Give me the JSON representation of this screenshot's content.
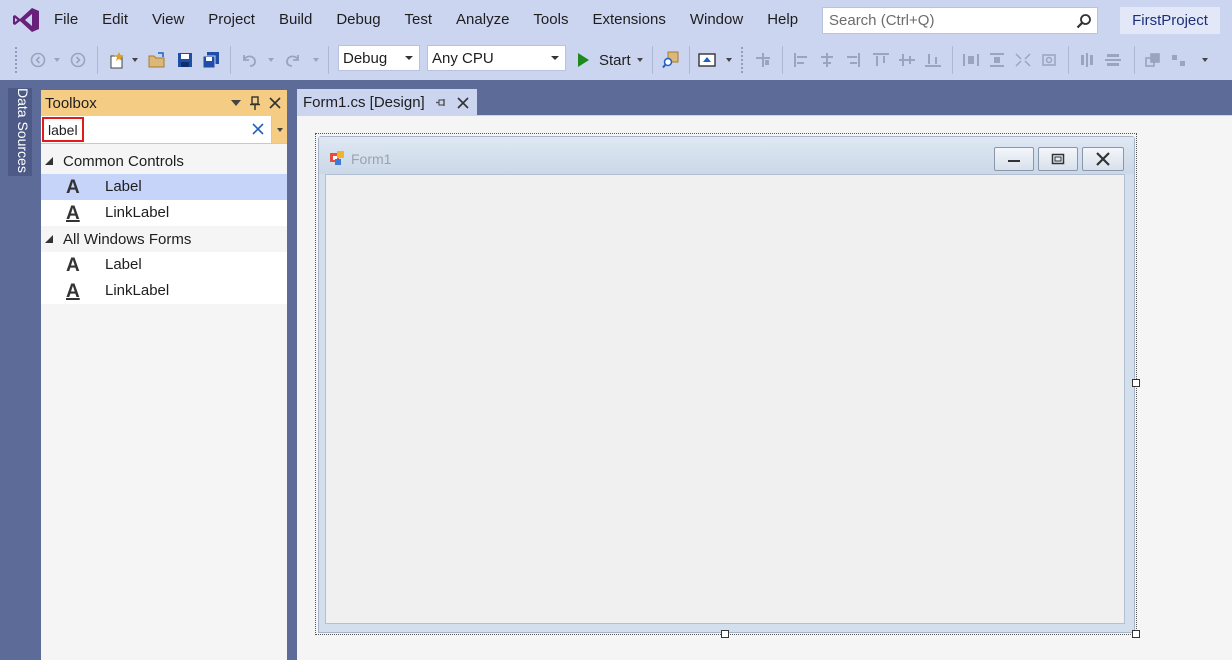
{
  "menu": {
    "items": [
      "File",
      "Edit",
      "View",
      "Project",
      "Build",
      "Debug",
      "Test",
      "Analyze",
      "Tools",
      "Extensions",
      "Window",
      "Help"
    ],
    "search_placeholder": "Search (Ctrl+Q)",
    "project_name": "FirstProject"
  },
  "toolbar": {
    "configuration": "Debug",
    "platform": "Any CPU",
    "start_label": "Start"
  },
  "side_tabs": {
    "data_sources": "Data Sources"
  },
  "toolbox": {
    "title": "Toolbox",
    "search_value": "label",
    "groups": [
      {
        "name": "Common Controls",
        "items": [
          {
            "label": "Label",
            "selected": true
          },
          {
            "label": "LinkLabel",
            "selected": false
          }
        ]
      },
      {
        "name": "All Windows Forms",
        "items": [
          {
            "label": "Label",
            "selected": false
          },
          {
            "label": "LinkLabel",
            "selected": false
          }
        ]
      }
    ]
  },
  "document_tab": {
    "title": "Form1.cs [Design]"
  },
  "form": {
    "title": "Form1"
  },
  "colors": {
    "chrome": "#ccd5f0",
    "background": "#5d6b99",
    "toolbox_header": "#f5cc84",
    "selection": "#c6d4fa",
    "accent": "#68217a"
  }
}
